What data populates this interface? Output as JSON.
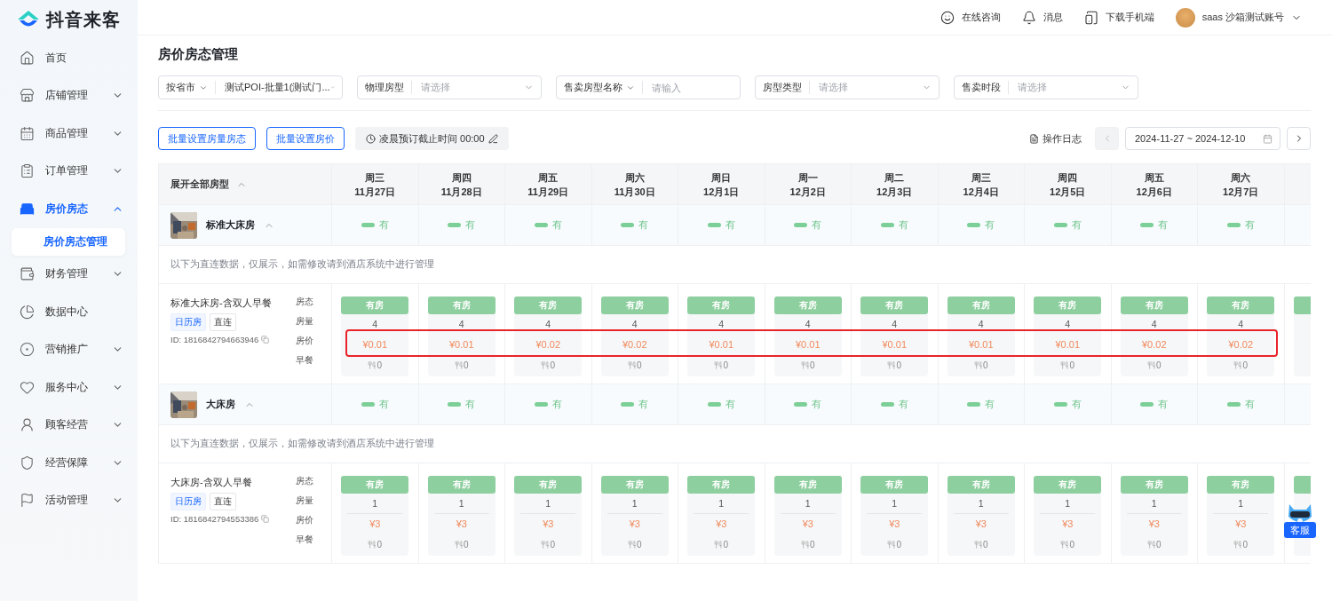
{
  "logo": {
    "text": "抖音来客"
  },
  "header": {
    "actions": [
      {
        "kind": "chat",
        "label": "在线咨询"
      },
      {
        "kind": "bell",
        "label": "消息"
      },
      {
        "kind": "device",
        "label": "下载手机端"
      }
    ],
    "user": "saas 沙箱测试账号"
  },
  "sidebar": {
    "items": [
      {
        "kind": "home",
        "label": "首页",
        "selected": false
      },
      {
        "kind": "store",
        "label": "店铺管理",
        "selected": false,
        "expanded": false
      },
      {
        "kind": "goods",
        "label": "商品管理",
        "selected": false,
        "expanded": false
      },
      {
        "kind": "orders",
        "label": "订单管理",
        "selected": false,
        "expanded": false
      },
      {
        "kind": "bed",
        "label": "房价房态",
        "selected": true,
        "expanded": true,
        "children": [
          {
            "label": "房价房态管理",
            "selected": true
          }
        ]
      },
      {
        "kind": "finance",
        "label": "财务管理",
        "selected": false,
        "expanded": false
      },
      {
        "kind": "data",
        "label": "数据中心",
        "selected": false
      },
      {
        "kind": "marketing",
        "label": "营销推广",
        "selected": false,
        "expanded": false
      },
      {
        "kind": "service",
        "label": "服务中心",
        "selected": false,
        "expanded": false
      },
      {
        "kind": "customer",
        "label": "顾客经营",
        "selected": false,
        "expanded": false
      },
      {
        "kind": "shield",
        "label": "经营保障",
        "selected": false,
        "expanded": false
      },
      {
        "kind": "flag",
        "label": "活动管理",
        "selected": false,
        "expanded": false
      }
    ]
  },
  "page_title": "房价房态管理",
  "filters": [
    {
      "label": "按省市",
      "label_dropdown": true,
      "kind": "select",
      "value": "测试POI-批量1(测试门..."
    },
    {
      "label": "物理房型",
      "label_dropdown": false,
      "kind": "select",
      "placeholder": "请选择"
    },
    {
      "label": "售卖房型名称",
      "label_dropdown": true,
      "kind": "input",
      "placeholder": "请输入"
    },
    {
      "label": "房型类型",
      "label_dropdown": false,
      "kind": "select",
      "placeholder": "请选择"
    },
    {
      "label": "售卖时段",
      "label_dropdown": false,
      "kind": "select",
      "placeholder": "请选择"
    }
  ],
  "toolbar": {
    "buttons": [
      "批量设置房量房态",
      "批量设置房价"
    ],
    "cutoff": "凌晨预订截止时间 00:00",
    "log": "操作日志",
    "date_range": "2024-11-27 ~ 2024-12-10",
    "prev_disabled": true
  },
  "table": {
    "header_label": "展开全部房型",
    "days": [
      {
        "weekday": "周三",
        "date": "11月27日"
      },
      {
        "weekday": "周四",
        "date": "11月28日"
      },
      {
        "weekday": "周五",
        "date": "11月29日"
      },
      {
        "weekday": "周六",
        "date": "11月30日"
      },
      {
        "weekday": "周日",
        "date": "12月1日"
      },
      {
        "weekday": "周一",
        "date": "12月2日"
      },
      {
        "weekday": "周二",
        "date": "12月3日"
      },
      {
        "weekday": "周三",
        "date": "12月4日"
      },
      {
        "weekday": "周四",
        "date": "12月5日"
      },
      {
        "weekday": "周五",
        "date": "12月6日"
      },
      {
        "weekday": "周六",
        "date": "12月7日"
      }
    ]
  },
  "room_types": [
    {
      "name": "标准大床房",
      "expanded": true,
      "availability": [
        "有",
        "有",
        "有",
        "有",
        "有",
        "有",
        "有",
        "有",
        "有",
        "有",
        "有"
      ],
      "note": "以下为直连数据，仅展示，如需修改请到酒店系统中进行管理",
      "rate_plans": [
        {
          "name": "标准大床房-含双人早餐",
          "tags": [
            {
              "label": "日历房",
              "kind": "primary"
            },
            {
              "label": "直连",
              "kind": "plain"
            }
          ],
          "id": "ID: 1816842794663946",
          "field_labels": [
            "房态",
            "房量",
            "房价",
            "早餐"
          ],
          "highlighted": true,
          "divider": false,
          "cells": [
            {
              "status": "有房",
              "count": "4",
              "price": "¥0.01",
              "breakfast": "0"
            },
            {
              "status": "有房",
              "count": "4",
              "price": "¥0.01",
              "breakfast": "0"
            },
            {
              "status": "有房",
              "count": "4",
              "price": "¥0.02",
              "breakfast": "0"
            },
            {
              "status": "有房",
              "count": "4",
              "price": "¥0.02",
              "breakfast": "0"
            },
            {
              "status": "有房",
              "count": "4",
              "price": "¥0.01",
              "breakfast": "0"
            },
            {
              "status": "有房",
              "count": "4",
              "price": "¥0.01",
              "breakfast": "0"
            },
            {
              "status": "有房",
              "count": "4",
              "price": "¥0.01",
              "breakfast": "0"
            },
            {
              "status": "有房",
              "count": "4",
              "price": "¥0.01",
              "breakfast": "0"
            },
            {
              "status": "有房",
              "count": "4",
              "price": "¥0.01",
              "breakfast": "0"
            },
            {
              "status": "有房",
              "count": "4",
              "price": "¥0.02",
              "breakfast": "0"
            },
            {
              "status": "有房",
              "count": "4",
              "price": "¥0.02",
              "breakfast": "0"
            }
          ]
        }
      ]
    },
    {
      "name": "大床房",
      "expanded": true,
      "availability": [
        "有",
        "有",
        "有",
        "有",
        "有",
        "有",
        "有",
        "有",
        "有",
        "有",
        "有"
      ],
      "note": "以下为直连数据，仅展示，如需修改请到酒店系统中进行管理",
      "rate_plans": [
        {
          "name": "大床房-含双人早餐",
          "tags": [
            {
              "label": "日历房",
              "kind": "primary"
            },
            {
              "label": "直连",
              "kind": "plain"
            }
          ],
          "id": "ID: 1816842794553386",
          "field_labels": [
            "房态",
            "房量",
            "房价",
            "早餐"
          ],
          "highlighted": false,
          "divider": true,
          "cells": [
            {
              "status": "有房",
              "count": "1",
              "price": "¥3",
              "breakfast": "0"
            },
            {
              "status": "有房",
              "count": "1",
              "price": "¥3",
              "breakfast": "0"
            },
            {
              "status": "有房",
              "count": "1",
              "price": "¥3",
              "breakfast": "0"
            },
            {
              "status": "有房",
              "count": "1",
              "price": "¥3",
              "breakfast": "0"
            },
            {
              "status": "有房",
              "count": "1",
              "price": "¥3",
              "breakfast": "0"
            },
            {
              "status": "有房",
              "count": "1",
              "price": "¥3",
              "breakfast": "0"
            },
            {
              "status": "有房",
              "count": "1",
              "price": "¥3",
              "breakfast": "0"
            },
            {
              "status": "有房",
              "count": "1",
              "price": "¥3",
              "breakfast": "0"
            },
            {
              "status": "有房",
              "count": "1",
              "price": "¥3",
              "breakfast": "0"
            },
            {
              "status": "有房",
              "count": "1",
              "price": "¥3",
              "breakfast": "0"
            },
            {
              "status": "有房",
              "count": "1",
              "price": "¥3",
              "breakfast": "0"
            }
          ]
        }
      ]
    }
  ],
  "help_button": {
    "label": "客服"
  }
}
